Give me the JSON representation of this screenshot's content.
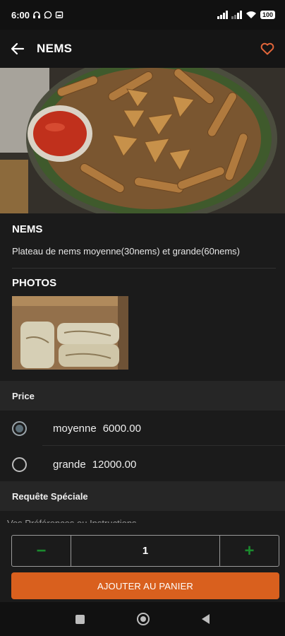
{
  "status_bar": {
    "time": "6:00",
    "battery": "100",
    "icons": [
      "headset-icon",
      "whatsapp-icon",
      "notification-icon",
      "signal-icon",
      "signal-icon",
      "wifi-icon",
      "battery-icon"
    ]
  },
  "app_bar": {
    "title": "NEMS",
    "back_icon": "arrow-left-icon",
    "favorite_icon": "heart-outline-icon",
    "accent": "#e2663a"
  },
  "product": {
    "name": "NEMS",
    "description": "Plateau de nems moyenne(30nems) et grande(60nems)"
  },
  "photos": {
    "title": "PHOTOS"
  },
  "price": {
    "title": "Price",
    "options": [
      {
        "size": "moyenne",
        "price": "6000.00",
        "selected": true
      },
      {
        "size": "grande",
        "price": "12000.00",
        "selected": false
      }
    ]
  },
  "special_request": {
    "title": "Requête Spéciale",
    "placeholder": "Vos Préférences ou Instructions"
  },
  "cart": {
    "minus": "−",
    "quantity": "1",
    "plus": "+",
    "add_label": "AJOUTER AU PANIER",
    "button_color": "#d9601e",
    "stepper_color": "#1b8a2e"
  }
}
